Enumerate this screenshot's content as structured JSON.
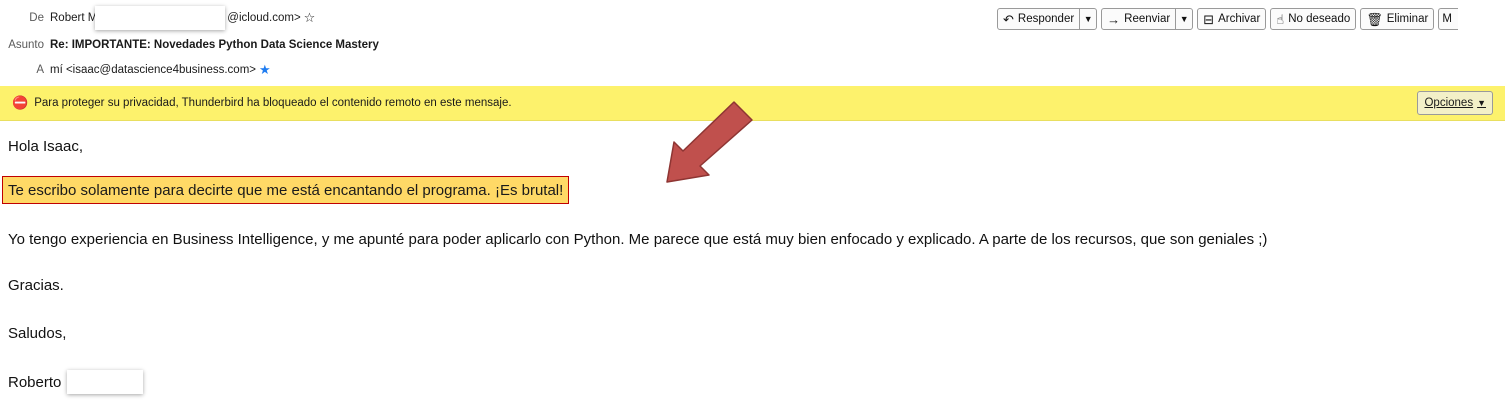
{
  "header": {
    "from_label": "De",
    "from_name": "Robert M",
    "from_domain": "@icloud.com>",
    "subject_label": "Asunto",
    "subject": "Re: IMPORTANTE: Novedades Python Data Science Mastery",
    "to_label": "A",
    "to": "mí <isaac@datascience4business.com>"
  },
  "toolbar": {
    "reply": "Responder",
    "forward": "Reenviar",
    "archive": "Archivar",
    "junk": "No deseado",
    "delete": "Eliminar",
    "more": "M"
  },
  "notice": {
    "text": "Para proteger su privacidad, Thunderbird ha bloqueado el contenido remoto en este mensaje.",
    "options": "Opciones"
  },
  "message": {
    "greeting": "Hola Isaac,",
    "highlight": "Te escribo solamente para decirte que me está encantando el programa. ¡Es brutal!",
    "paragraph": "Yo tengo experiencia en Business Intelligence, y me apunté para poder aplicarlo con Python. Me parece que está muy bien enfocado y explicado. A parte de los recursos, que son geniales ;)",
    "thanks": "Gracias.",
    "closing": "Saludos,",
    "signature": "Roberto"
  },
  "colors": {
    "notice_bg": "#fdf26c",
    "highlight_bg": "#ffd966",
    "highlight_border": "#c00000",
    "arrow_fill": "#c0504d",
    "star_blue": "#1f7cf0"
  }
}
